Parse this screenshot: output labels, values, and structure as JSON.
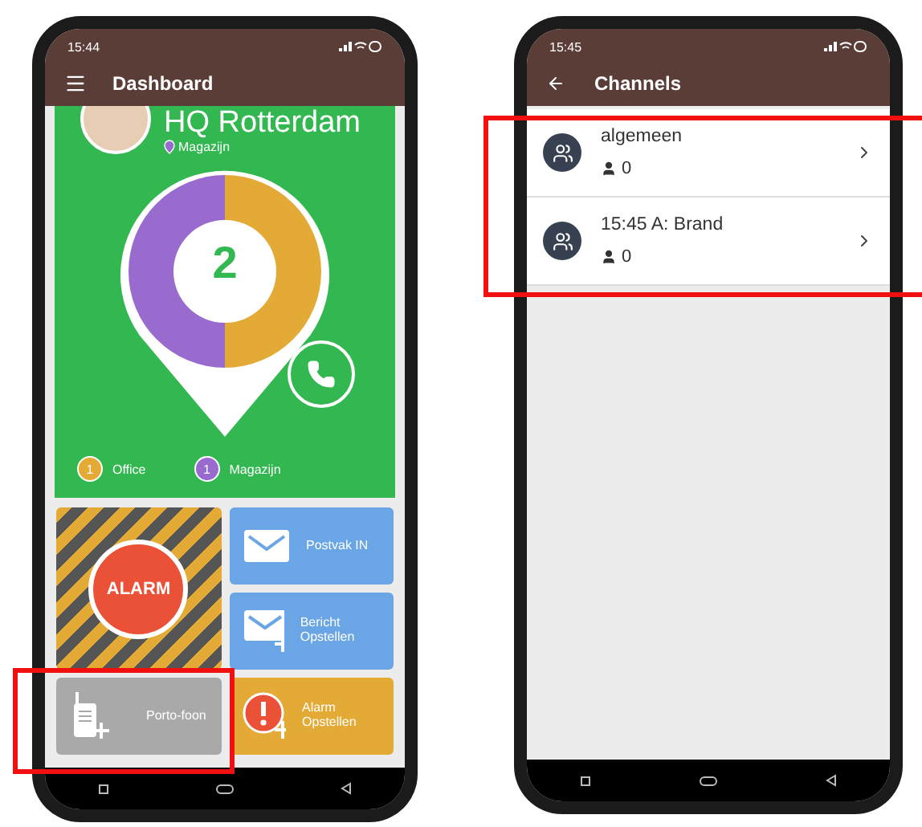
{
  "dashboard": {
    "status_time": "15:44",
    "highlighted": true,
    "title": "Dashboard",
    "location": {
      "name": "HQ Rotterdam",
      "zone": "Magazijn"
    },
    "count": "2",
    "legend": [
      {
        "count": "1",
        "label": "Office",
        "color": "#e3ab35"
      },
      {
        "count": "1",
        "label": "Magazijn",
        "color": "#9a6bcf"
      }
    ],
    "tiles": [
      {
        "kind": "alarm",
        "label": "ALARM"
      },
      {
        "kind": "inbox",
        "label": "Postvak IN"
      },
      {
        "kind": "compose",
        "label": "Bericht Opstellen"
      },
      {
        "kind": "radio",
        "label": "Porto-foon"
      },
      {
        "kind": "alarm_compose",
        "label": "Alarm Opstellen"
      }
    ]
  },
  "channels_screen": {
    "status_time": "15:45",
    "title": "Channels",
    "highlighted": true,
    "channels": [
      {
        "name": "algemeen",
        "members": "0"
      },
      {
        "name": "15:45 A: Brand",
        "members": "0"
      }
    ]
  }
}
